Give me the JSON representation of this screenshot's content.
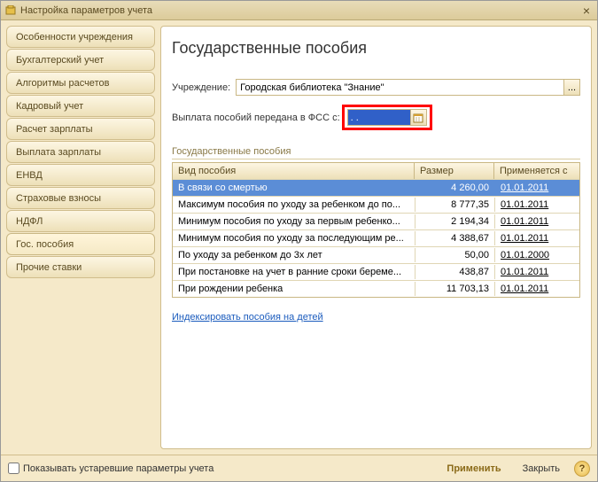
{
  "window": {
    "title": "Настройка параметров учета"
  },
  "sidebar": {
    "items": [
      {
        "label": "Особенности учреждения"
      },
      {
        "label": "Бухгалтерский учет"
      },
      {
        "label": "Алгоритмы расчетов"
      },
      {
        "label": "Кадровый учет"
      },
      {
        "label": "Расчет зарплаты"
      },
      {
        "label": "Выплата зарплаты"
      },
      {
        "label": "ЕНВД"
      },
      {
        "label": "Страховые взносы"
      },
      {
        "label": "НДФЛ"
      },
      {
        "label": "Гос. пособия"
      },
      {
        "label": "Прочие ставки"
      }
    ],
    "active_index": 9
  },
  "main": {
    "heading": "Государственные пособия",
    "institution_label": "Учреждение:",
    "institution_value": "Городская библиотека \"Знание\"",
    "fss_label": "Выплата пособий передана в ФСС с:",
    "fss_date_value": "  .  .",
    "section_title": "Государственные пособия",
    "table": {
      "headers": [
        "Вид пособия",
        "Размер",
        "Применяется с"
      ],
      "rows": [
        {
          "name": "В связи со смертью",
          "amount": "4 260,00",
          "date": "01.01.2011",
          "selected": true
        },
        {
          "name": "Максимум пособия по уходу за ребенком до по...",
          "amount": "8 777,35",
          "date": "01.01.2011"
        },
        {
          "name": "Минимум пособия по уходу за первым ребенко...",
          "amount": "2 194,34",
          "date": "01.01.2011"
        },
        {
          "name": "Минимум пособия по уходу за последующим ре...",
          "amount": "4 388,67",
          "date": "01.01.2011"
        },
        {
          "name": "По уходу за ребенком до 3х лет",
          "amount": "50,00",
          "date": "01.01.2000"
        },
        {
          "name": "При постановке на учет в ранние сроки береме...",
          "amount": "438,87",
          "date": "01.01.2011"
        },
        {
          "name": "При рождении ребенка",
          "amount": "11 703,13",
          "date": "01.01.2011"
        }
      ]
    },
    "index_link": "Индексировать пособия на детей"
  },
  "footer": {
    "checkbox_label": "Показывать устаревшие параметры учета",
    "apply": "Применить",
    "close": "Закрыть"
  }
}
